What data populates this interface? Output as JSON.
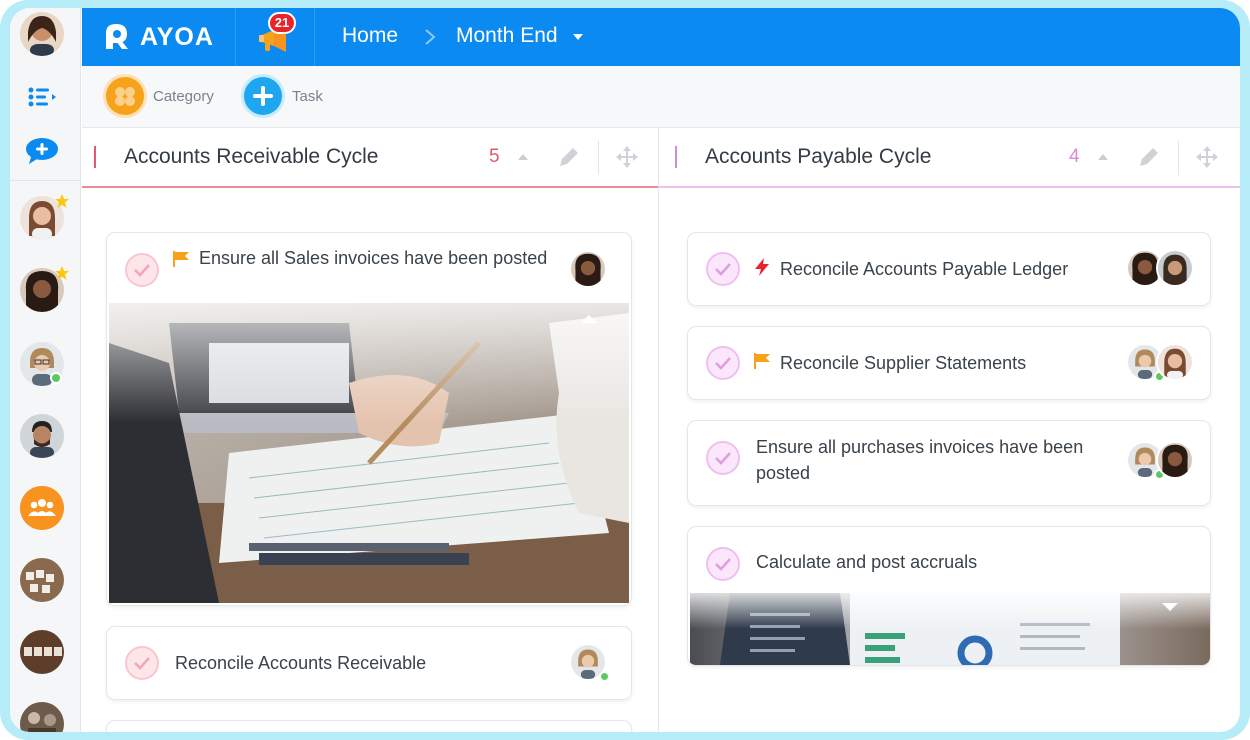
{
  "app": {
    "logo_text": "AYOA",
    "notifications_count": "21"
  },
  "breadcrumb": {
    "home": "Home",
    "separator": ">",
    "current": "Month End"
  },
  "toolbar": {
    "category_label": "Category",
    "task_label": "Task"
  },
  "columns": [
    {
      "title": "Accounts Receivable Cycle",
      "count": "5",
      "color": "#e05a6e",
      "tasks": [
        {
          "title": "Ensure all Sales invoices have been posted",
          "icon": "flag-icon"
        },
        {
          "title": "Reconcile Accounts Receivable",
          "icon": ""
        }
      ]
    },
    {
      "title": "Accounts Payable Cycle",
      "count": "4",
      "color": "#d889d8",
      "tasks": [
        {
          "title": "Reconcile Accounts Payable Ledger",
          "icon": "lightning-icon"
        },
        {
          "title": "Reconcile Supplier Statements",
          "icon": "flag-icon"
        },
        {
          "title": "Ensure all purchases invoices have been posted",
          "icon": ""
        },
        {
          "title": "Calculate and post accruals",
          "icon": ""
        }
      ]
    }
  ],
  "colors": {
    "brand_blue": "#0b8bf2",
    "receivable_pink": "#e05a6e",
    "payable_pink": "#d889d8",
    "orange": "#f7a21b",
    "online_green": "#5cc85e"
  }
}
